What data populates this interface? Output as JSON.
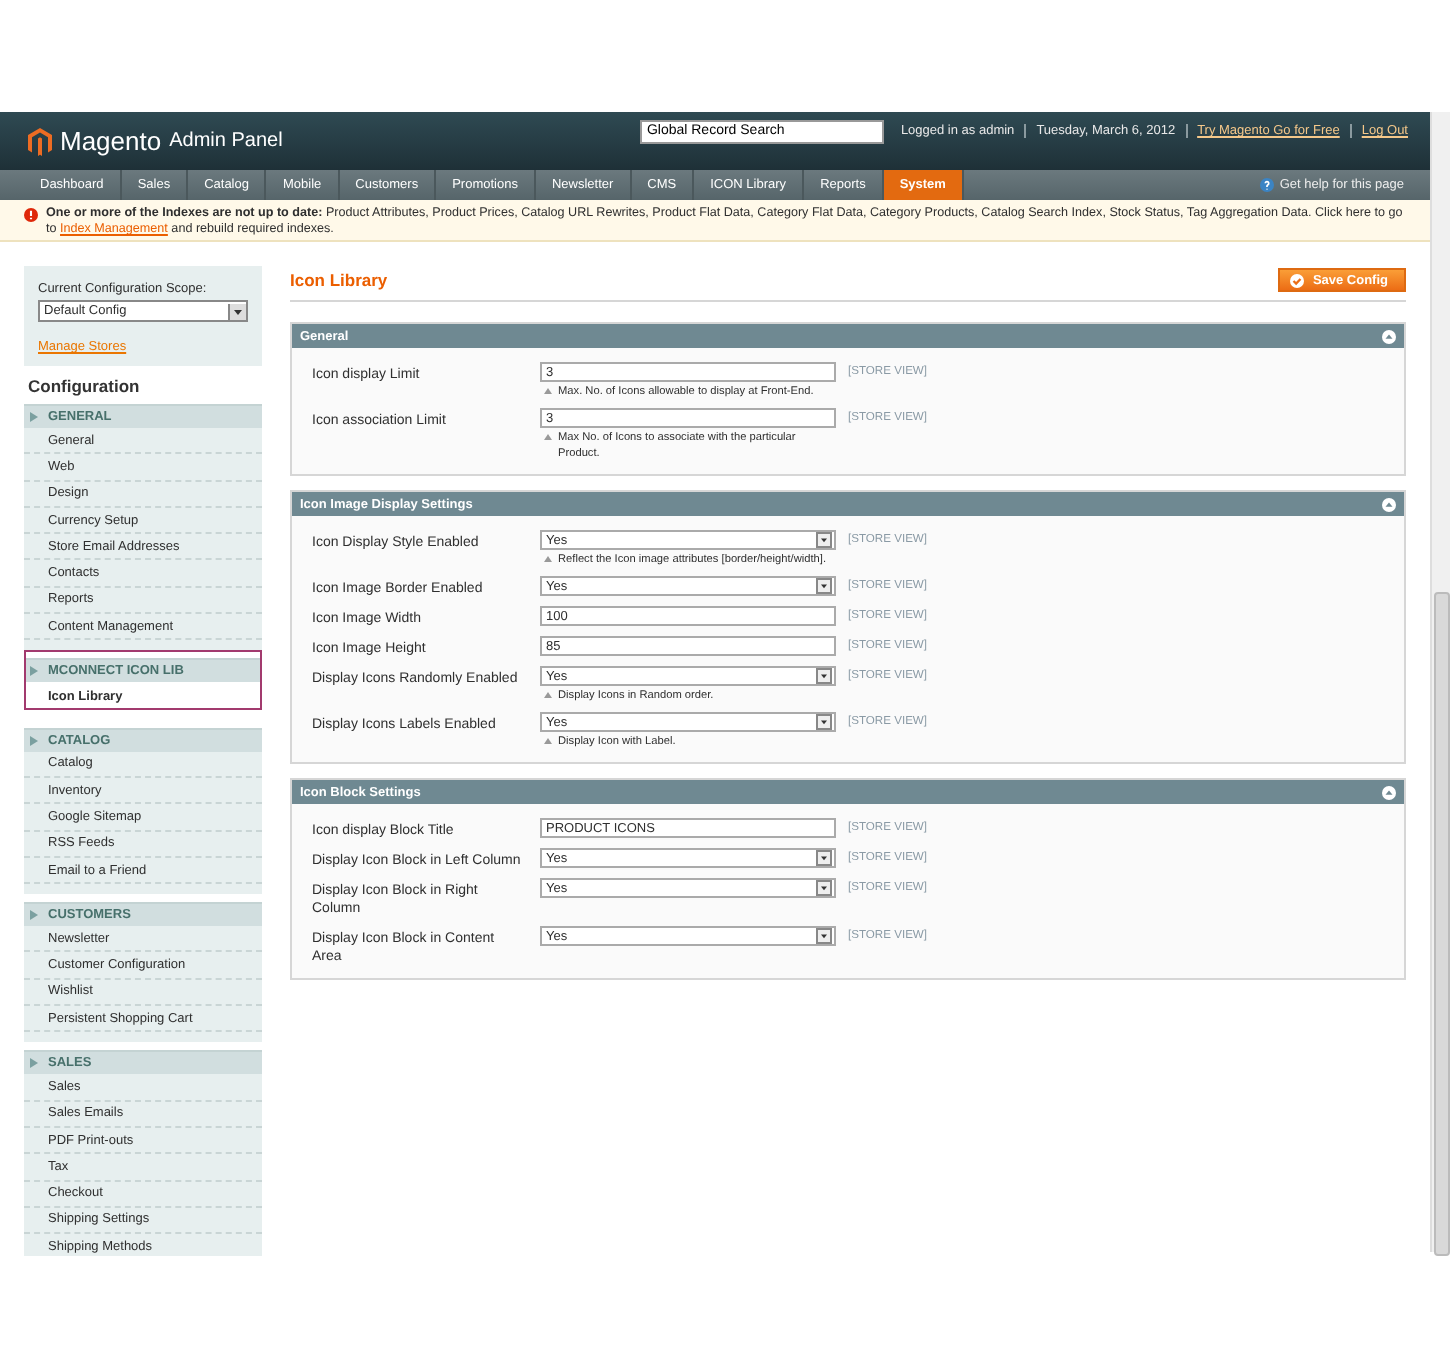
{
  "header": {
    "logo_text": "Magento",
    "logo_sub": "Admin Panel",
    "search": {
      "value": "Global Record Search"
    },
    "user_info": "Logged in as admin",
    "date": "Tuesday, March 6, 2012",
    "links": [
      "Try Magento Go for Free",
      "Log Out"
    ]
  },
  "nav": {
    "items": [
      {
        "label": "Dashboard",
        "selected": false
      },
      {
        "label": "Sales",
        "selected": false
      },
      {
        "label": "Catalog",
        "selected": false
      },
      {
        "label": "Mobile",
        "selected": false
      },
      {
        "label": "Customers",
        "selected": false
      },
      {
        "label": "Promotions",
        "selected": false
      },
      {
        "label": "Newsletter",
        "selected": false
      },
      {
        "label": "CMS",
        "selected": false
      },
      {
        "label": "ICON Library",
        "selected": false
      },
      {
        "label": "Reports",
        "selected": false
      },
      {
        "label": "System",
        "selected": true
      }
    ],
    "help": "Get help for this page"
  },
  "notice": {
    "text": "**One or more of the Indexes are not up to date:** Product Attributes, Product Prices, Catalog URL Rewrites, Product Flat Data, Category Flat Data, Category Products, Catalog Search Index, Stock Status, Tag Aggregation Data. Click here to go to",
    "link": "Index Management",
    "after": "and rebuild required indexes."
  },
  "sidebar": {
    "scope_label": "Current Configuration Scope:",
    "scope_value": "Default Config",
    "manage_stores": "Manage Stores",
    "title": "Configuration",
    "sections": [
      {
        "title": "GENERAL",
        "highlighted": false,
        "items": [
          {
            "label": "General",
            "selected": false
          },
          {
            "label": "Web",
            "selected": false
          },
          {
            "label": "Design",
            "selected": false
          },
          {
            "label": "Currency Setup",
            "selected": false
          },
          {
            "label": "Store Email Addresses",
            "selected": false
          },
          {
            "label": "Contacts",
            "selected": false
          },
          {
            "label": "Reports",
            "selected": false
          },
          {
            "label": "Content Management",
            "selected": false
          }
        ]
      },
      {
        "title": "MCONNECT ICON LIB",
        "highlighted": true,
        "items": [
          {
            "label": "Icon Library",
            "selected": true
          }
        ]
      },
      {
        "title": "CATALOG",
        "highlighted": false,
        "items": [
          {
            "label": "Catalog",
            "selected": false
          },
          {
            "label": "Inventory",
            "selected": false
          },
          {
            "label": "Google Sitemap",
            "selected": false
          },
          {
            "label": "RSS Feeds",
            "selected": false
          },
          {
            "label": "Email to a Friend",
            "selected": false
          }
        ]
      },
      {
        "title": "CUSTOMERS",
        "highlighted": false,
        "items": [
          {
            "label": "Newsletter",
            "selected": false
          },
          {
            "label": "Customer Configuration",
            "selected": false
          },
          {
            "label": "Wishlist",
            "selected": false
          },
          {
            "label": "Persistent Shopping Cart",
            "selected": false
          }
        ]
      },
      {
        "title": "SALES",
        "highlighted": false,
        "items": [
          {
            "label": "Sales",
            "selected": false
          },
          {
            "label": "Sales Emails",
            "selected": false
          },
          {
            "label": "PDF Print-outs",
            "selected": false
          },
          {
            "label": "Tax",
            "selected": false
          },
          {
            "label": "Checkout",
            "selected": false
          },
          {
            "label": "Shipping Settings",
            "selected": false
          },
          {
            "label": "Shipping Methods",
            "selected": false
          }
        ]
      }
    ]
  },
  "main": {
    "title": "Icon Library",
    "save_button": "Save Config",
    "fieldsets": [
      {
        "title": "General",
        "fields": [
          {
            "kind": "text",
            "label": "Icon display Limit",
            "value": "3",
            "note": "Max. No. of Icons allowable to display at Front-End.",
            "scope": "[STORE VIEW]"
          },
          {
            "kind": "text",
            "label": "Icon association Limit",
            "value": "3",
            "note": "Max No. of Icons to associate with the particular Product.",
            "scope": "[STORE VIEW]"
          }
        ]
      },
      {
        "title": "Icon Image Display Settings",
        "fields": [
          {
            "kind": "select",
            "label": "Icon Display Style Enabled",
            "value": "Yes",
            "note": "Reflect the Icon image attributes [border/height/width].",
            "scope": "[STORE VIEW]"
          },
          {
            "kind": "select",
            "label": "Icon Image Border Enabled",
            "value": "Yes",
            "scope": "[STORE VIEW]"
          },
          {
            "kind": "text",
            "label": "Icon Image Width",
            "value": "100",
            "scope": "[STORE VIEW]"
          },
          {
            "kind": "text",
            "label": "Icon Image Height",
            "value": "85",
            "scope": "[STORE VIEW]"
          },
          {
            "kind": "select",
            "label": "Display Icons Randomly Enabled",
            "value": "Yes",
            "note": "Display Icons in Random order.",
            "scope": "[STORE VIEW]"
          },
          {
            "kind": "select",
            "label": "Display Icons Labels Enabled",
            "value": "Yes",
            "note": "Display Icon with Label.",
            "scope": "[STORE VIEW]"
          }
        ]
      },
      {
        "title": "Icon Block Settings",
        "fields": [
          {
            "kind": "text",
            "label": "Icon display Block Title",
            "value": "PRODUCT ICONS",
            "scope": "[STORE VIEW]"
          },
          {
            "kind": "select",
            "label": "Display Icon Block in Left Column",
            "value": "Yes",
            "scope": "[STORE VIEW]"
          },
          {
            "kind": "select",
            "label": "Display Icon Block in Right Column",
            "value": "Yes",
            "scope": "[STORE VIEW]"
          },
          {
            "kind": "select",
            "label": "Display Icon Block in Content Area",
            "value": "Yes",
            "scope": "[STORE VIEW]"
          }
        ]
      }
    ]
  }
}
